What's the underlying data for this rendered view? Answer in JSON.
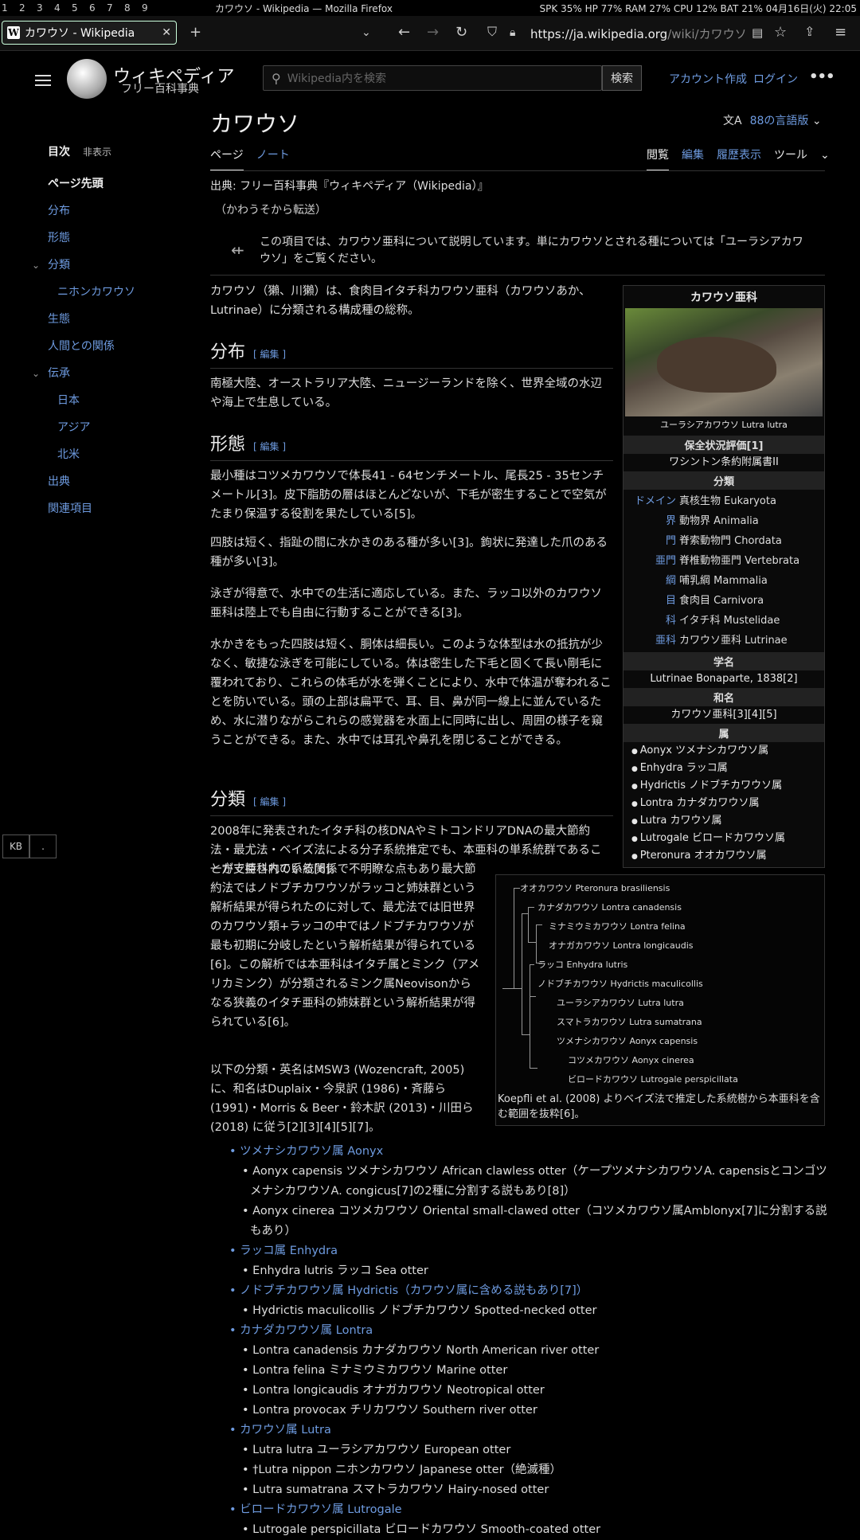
{
  "system": {
    "workspaces": [
      "1",
      "2",
      "3",
      "4",
      "5",
      "6",
      "7",
      "8",
      "9"
    ],
    "window_title": "カワウソ - Wikipedia — Mozilla Firefox",
    "status": "SPK  35% HP  77%  RAM 27%  CPU 12%  BAT 21% 04月16日(火) 22:05"
  },
  "browser": {
    "tab_title": "カワウソ - Wikipedia",
    "url_domain": "https://ja.wikipedia.org",
    "url_path": "/wiki/カワウソ"
  },
  "header": {
    "site_name": "ウィキペディア",
    "site_sub": "フリー百科事典",
    "search_placeholder": "Wikipedia内を検索",
    "search_button": "検索",
    "create_account": "アカウント作成",
    "login": "ログイン"
  },
  "toc": {
    "title": "目次",
    "hide": "非表示",
    "items": [
      "ページ先頭",
      "分布",
      "形態",
      "分類",
      "ニホンカワウソ",
      "生態",
      "人間との関係",
      "伝承",
      "日本",
      "アジア",
      "北米",
      "出典",
      "関連項目"
    ]
  },
  "kb": {
    "k1": "KB",
    "k2": "."
  },
  "page": {
    "title": "カワウソ",
    "languages": "88の言語版",
    "tab_page": "ページ",
    "tab_talk": "ノート",
    "tab_read": "閲覧",
    "tab_edit": "編集",
    "tab_history": "履歴表示",
    "tab_tools": "ツール",
    "source": "出典: フリー百科事典『ウィキペディア（Wikipedia）』",
    "redirect": "（かわうそから転送）",
    "hatnote": "この項目では、カワウソ亜科について説明しています。単にカワウソとされる種については「ユーラシアカワウソ」をご覧ください。",
    "edit": "[ 編集 ]"
  },
  "content": {
    "intro": "カワウソ（獺、川獺）は、食肉目イタチ科カワウソ亜科（カワウソあか、Lutrinae）に分類される構成種の総称。",
    "h_dist": "分布",
    "dist": "南極大陸、オーストラリア大陸、ニュージーランドを除く、世界全域の水辺や海上で生息している。",
    "h_morph": "形態",
    "m1": "最小種はコツメカワウソで体長41 - 64センチメートル、尾長25 - 35センチメートル[3]。皮下脂肪の層はほとんどないが、下毛が密生することで空気がたまり保温する役割を果たしている[5]。",
    "m2": "四肢は短く、指趾の間に水かきのある種が多い[3]。鉤状に発達した爪のある種が多い[3]。",
    "m3": "泳ぎが得意で、水中での生活に適応している。また、ラッコ以外のカワウソ亜科は陸上でも自由に行動することができる[3]。",
    "m4": "水かきをもった四肢は短く、胴体は細長い。このような体型は水の抵抗が少なく、敏捷な泳ぎを可能にしている。体は密生した下毛と固くて長い剛毛に覆われており、これらの体毛が水を弾くことにより、水中で体温が奪われることを防いでいる。頭の上部は扁平で、耳、目、鼻が同一線上に並んでいるため、水に潜りながらこれらの感覚器を水面上に同時に出し、周囲の様子を窺うことができる。また、水中では耳孔や鼻孔を閉じることができる。",
    "h_class": "分類",
    "c1a": "2008年に発表されたイタチ科の核DNAやミトコンドリアDNAの最大節約法・最尤法・ベイズ法による分子系統推定でも、本亜科の単系統群であることが支持されている[6]。",
    "c1b": "一方で亜科内の系統関係で不明瞭な点もあり最大節約法ではノドブチカワウソがラッコと姉妹群という解析結果が得られたのに対して、最尤法では旧世界のカワウソ類+ラッコの中ではノドブチカワウソが最も初期に分岐したという解析結果が得られている[6]。この解析では本亜科はイタチ属とミンク（アメリカミンク）が分類されるミンク属Neovisonからなる狭義のイタチ亜科の姉妹群という解析結果が得られている[6]。",
    "c2": "以下の分類・英名はMSW3 (Wozencraft, 2005)に、和名はDuplaix・今泉訳 (1986)・斉藤ら (1991)・Morris & Beer・鈴木訳 (2013)・川田ら (2018) に従う[2][3][4][5][7]。"
  },
  "infobox": {
    "title": "カワウソ亜科",
    "img_caption": "ユーラシアカワウソ Lutra lutra",
    "s_status": "保全状況評価[1]",
    "status": "ワシントン条約附属書II",
    "s_class": "分類",
    "ranks": [
      [
        "ドメイン",
        "真核生物 Eukaryota"
      ],
      [
        "界",
        "動物界 Animalia"
      ],
      [
        "門",
        "脊索動物門 Chordata"
      ],
      [
        "亜門",
        "脊椎動物亜門 Vertebrata"
      ],
      [
        "綱",
        "哺乳綱 Mammalia"
      ],
      [
        "目",
        "食肉目 Carnivora"
      ],
      [
        "科",
        "イタチ科 Mustelidae"
      ],
      [
        "亜科",
        "カワウソ亜科 Lutrinae"
      ]
    ],
    "s_sci": "学名",
    "sci": "Lutrinae Bonaparte, 1838[2]",
    "s_jp": "和名",
    "jp": "カワウソ亜科[3][4][5]",
    "s_genus": "属",
    "genera": [
      "Aonyx ツメナシカワウソ属",
      "Enhydra ラッコ属",
      "Hydrictis ノドブチカワウソ属",
      "Lontra カナダカワウソ属",
      "Lutra カワウソ属",
      "Lutrogale ビロードカワウソ属",
      "Pteronura オオカワウソ属"
    ]
  },
  "tree": {
    "taxa": [
      "オオカワウソ Pteronura brasiliensis",
      "カナダカワウソ Lontra canadensis",
      "ミナミウミカワウソ Lontra felina",
      "オナガカワウソ Lontra longicaudis",
      "ラッコ Enhydra lutris",
      "ノドブチカワウソ Hydrictis maculicollis",
      "ユーラシアカワウソ Lutra lutra",
      "スマトラカワウソ Lutra sumatrana",
      "ツメナシカワウソ Aonyx capensis",
      "コツメカワウソ Aonyx cinerea",
      "ビロードカワウソ Lutrogale perspicillata"
    ],
    "caption": "Koepfli et al. (2008) よりベイズ法で推定した系統樹から本亜科を含む範囲を抜粋[6]。"
  },
  "species": [
    {
      "g": "ツメナシカワウソ属 Aonyx",
      "sp": [
        "Aonyx capensis ツメナシカワウソ African clawless otter（ケープツメナシカワウソA. capensisとコンゴツメナシカワウソA. congicus[7]の2種に分割する説もあり[8]）",
        "Aonyx cinerea コツメカワウソ Oriental small-clawed otter（コツメカワウソ属Amblonyx[7]に分割する説もあり）"
      ]
    },
    {
      "g": "ラッコ属 Enhydra",
      "sp": [
        "Enhydra lutris ラッコ Sea otter"
      ]
    },
    {
      "g": "ノドブチカワウソ属 Hydrictis（カワウソ属に含める説もあり[7]）",
      "sp": [
        "Hydrictis maculicollis ノドブチカワウソ Spotted-necked otter"
      ]
    },
    {
      "g": "カナダカワウソ属 Lontra",
      "sp": [
        "Lontra canadensis カナダカワウソ North American river otter",
        "Lontra felina ミナミウミカワウソ Marine otter",
        "Lontra longicaudis オナガカワウソ Neotropical otter",
        "Lontra provocax チリカワウソ Southern river otter"
      ]
    },
    {
      "g": "カワウソ属 Lutra",
      "sp": [
        "Lutra lutra ユーラシアカワウソ European otter",
        "†Lutra nippon ニホンカワウソ Japanese otter（絶滅種）",
        "Lutra sumatrana スマトラカワウソ Hairy-nosed otter"
      ]
    },
    {
      "g": "ビロードカワウソ属 Lutrogale",
      "sp": [
        "Lutrogale perspicillata ビロードカワウソ Smooth-coated otter"
      ]
    }
  ]
}
